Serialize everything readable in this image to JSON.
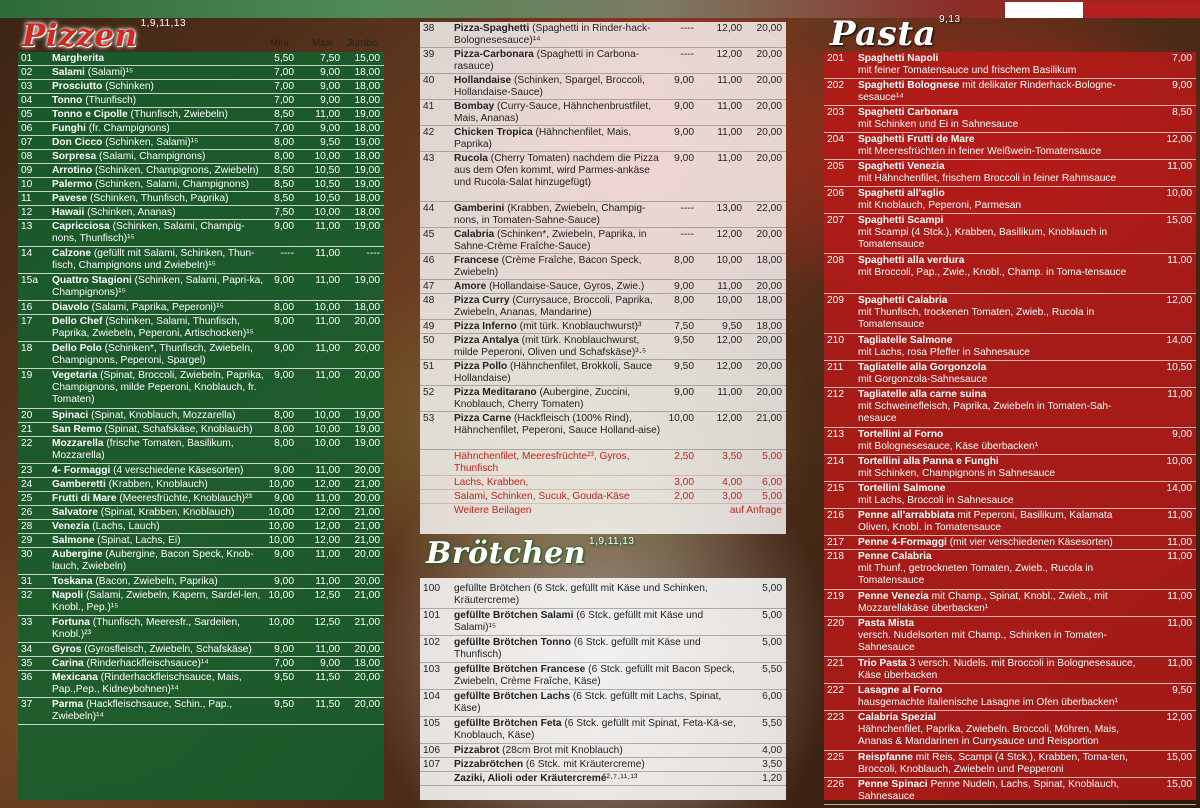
{
  "pizzen": {
    "title": "Pizzen",
    "sup": "1,9,11,13",
    "col_mini": "Mini",
    "col_maxi": "Maxi",
    "col_jumbo": "Jumbo",
    "items": [
      {
        "n": "01",
        "name": "Margherita",
        "desc": "",
        "p": [
          "5,50",
          "7,50",
          "15,00"
        ]
      },
      {
        "n": "02",
        "name": "Salami",
        "desc": " (Salami)¹⁵",
        "p": [
          "7,00",
          "9,00",
          "18,00"
        ]
      },
      {
        "n": "03",
        "name": "Prosciutto",
        "desc": " (Schinken)",
        "p": [
          "7,00",
          "9,00",
          "18,00"
        ]
      },
      {
        "n": "04",
        "name": "Tonno",
        "desc": " (Thunfisch)",
        "p": [
          "7,00",
          "9,00",
          "18,00"
        ]
      },
      {
        "n": "05",
        "name": "Tonno e Cipolle",
        "desc": " (Thunfisch, Zwiebeln)",
        "p": [
          "8,50",
          "11,00",
          "19,00"
        ]
      },
      {
        "n": "06",
        "name": "Funghi",
        "desc": " (fr. Champignons)",
        "p": [
          "7,00",
          "9,00",
          "18,00"
        ]
      },
      {
        "n": "07",
        "name": "Don Cicco",
        "desc": " (Schinken, Salami)¹⁵",
        "p": [
          "8,00",
          "9,50",
          "19,00"
        ]
      },
      {
        "n": "08",
        "name": "Sorpresa",
        "desc": " (Salami, Champignons)",
        "p": [
          "8,00",
          "10,00",
          "18,00"
        ]
      },
      {
        "n": "09",
        "name": "Arrotino",
        "desc": " (Schinken, Champignons, Zwiebeln)",
        "p": [
          "8,50",
          "10,50",
          "19,00"
        ]
      },
      {
        "n": "10",
        "name": "Palermo",
        "desc": " (Schinken, Salami, Champignons)",
        "p": [
          "8,50",
          "10,50",
          "19,00"
        ]
      },
      {
        "n": "11",
        "name": "Pavese",
        "desc": " (Schinken, Thunfisch, Paprika)",
        "p": [
          "8,50",
          "10,50",
          "18,00"
        ]
      },
      {
        "n": "12",
        "name": "Hawaii",
        "desc": " (Schinken, Ananas)",
        "p": [
          "7,50",
          "10,00",
          "18,00"
        ]
      },
      {
        "n": "13",
        "name": "Capricciosa",
        "desc": " (Schinken, Salami, Champig-nons, Thunfisch)¹⁵",
        "p": [
          "9,00",
          "11,00",
          "19,00"
        ]
      },
      {
        "n": "14",
        "name": "Calzone",
        "desc": " (gefüllt mit Salami, Schinken, Thun-fisch, Champignons und Zwiebeln)¹⁵",
        "p": [
          "----",
          "11,00",
          "----"
        ]
      },
      {
        "n": "15a",
        "name": "Quattro Stagioni",
        "desc": " (Schinken, Salami, Papri-ka, Champignons)¹⁵",
        "p": [
          "9,00",
          "11,00",
          "19,00"
        ]
      },
      {
        "n": "16",
        "name": "Diavolo",
        "desc": " (Salami, Paprika, Peperoni)¹⁵",
        "p": [
          "8,00",
          "10,00",
          "18,00"
        ]
      },
      {
        "n": "17",
        "name": "Dello Chef",
        "desc": " (Schinken, Salami, Thunfisch, Paprika, Zwiebeln, Peperoni, Artischocken)¹⁵",
        "p": [
          "9,00",
          "11,00",
          "20,00"
        ]
      },
      {
        "n": "18",
        "name": "Dello Polo",
        "desc": " (Schinken*, Thunfisch, Zwiebeln, Champignons, Peperoni, Spargel)",
        "p": [
          "9,00",
          "11,00",
          "20,00"
        ]
      },
      {
        "n": "19",
        "name": "Vegetaria",
        "desc": " (Spinat, Broccoli, Zwiebeln, Paprika, Champignons, milde Peperoni, Knoblauch, fr. Tomaten)",
        "p": [
          "9,00",
          "11,00",
          "20,00"
        ]
      },
      {
        "n": "20",
        "name": "Spinaci",
        "desc": " (Spinat, Knoblauch, Mozzarella)",
        "p": [
          "8,00",
          "10,00",
          "19,00"
        ]
      },
      {
        "n": "21",
        "name": "San Remo",
        "desc": " (Spinat, Schafskäse, Knoblauch)",
        "p": [
          "8,00",
          "10,00",
          "19,00"
        ]
      },
      {
        "n": "22",
        "name": "Mozzarella",
        "desc": " (frische Tomaten, Basilikum, Mozzarella)",
        "p": [
          "8,00",
          "10,00",
          "19,00"
        ]
      },
      {
        "n": "23",
        "name": "4- Formaggi",
        "desc": " (4 verschiedene Käsesorten)",
        "p": [
          "9,00",
          "11,00",
          "20,00"
        ]
      },
      {
        "n": "24",
        "name": "Gamberetti",
        "desc": " (Krabben, Knoblauch)",
        "p": [
          "10,00",
          "12,00",
          "21,00"
        ]
      },
      {
        "n": "25",
        "name": "Frutti di Mare",
        "desc": " (Meeresfrüchte, Knoblauch)²³",
        "p": [
          "9,00",
          "11,00",
          "20,00"
        ]
      },
      {
        "n": "26",
        "name": "Salvatore",
        "desc": " (Spinat, Krabben, Knoblauch)",
        "p": [
          "10,00",
          "12,00",
          "21,00"
        ]
      },
      {
        "n": "28",
        "name": "Venezia",
        "desc": " (Lachs, Lauch)",
        "p": [
          "10,00",
          "12,00",
          "21,00"
        ]
      },
      {
        "n": "29",
        "name": "Salmone",
        "desc": " (Spinat, Lachs, Ei)",
        "p": [
          "10,00",
          "12,00",
          "21,00"
        ]
      },
      {
        "n": "30",
        "name": "Aubergine",
        "desc": " (Aubergine, Bacon Speck, Knob-lauch, Zwiebeln)",
        "p": [
          "9,00",
          "11,00",
          "20,00"
        ]
      },
      {
        "n": "31",
        "name": "Toskana",
        "desc": " (Bacon, Zwiebeln, Paprika)",
        "p": [
          "9,00",
          "11,00",
          "20,00"
        ]
      },
      {
        "n": "32",
        "name": "Napoli",
        "desc": " (Salami, Zwiebeln, Kapern, Sardel-len, Knobl., Pep.)¹⁵",
        "p": [
          "10,00",
          "12,50",
          "21,00"
        ]
      },
      {
        "n": "33",
        "name": "Fortuna",
        "desc": " (Thunfisch, Meeresfr., Sardeilen, Knobl.)²³",
        "p": [
          "10,00",
          "12,50",
          "21,00"
        ]
      },
      {
        "n": "34",
        "name": "Gyros",
        "desc": " (Gyrosfleisch, Zwiebeln, Schafskäse)",
        "p": [
          "9,00",
          "11,00",
          "20,00"
        ]
      },
      {
        "n": "35",
        "name": "Carina",
        "desc": " (Rinderhackfleischsauce)¹⁴",
        "p": [
          "7,00",
          "9,00",
          "18,00"
        ]
      },
      {
        "n": "36",
        "name": "Mexicana",
        "desc": " (Rinderhackfleischsauce, Mais, Pap.,Pep., Kidneybohnen)¹⁴",
        "p": [
          "9,50",
          "11,50",
          "20,00"
        ]
      },
      {
        "n": "37",
        "name": "Parma",
        "desc": " (Hackfleischsauce, Schin., Pap., Zwiebeln)¹⁴",
        "p": [
          "9,50",
          "11,50",
          "20,00"
        ]
      }
    ]
  },
  "pizzen2": {
    "items": [
      {
        "n": "38",
        "name": "Pizza-Spaghetti",
        "desc": " (Spaghetti in Rinder-hack-Bolognesesauce)¹⁴",
        "p": [
          "----",
          "12,00",
          "20,00"
        ]
      },
      {
        "n": "39",
        "name": "Pizza-Carbonara",
        "desc": " (Spaghetti in Carbona-rasauce)",
        "p": [
          "----",
          "12,00",
          "20,00"
        ]
      },
      {
        "n": "40",
        "name": "Hollandaise",
        "desc": " (Schinken, Spargel, Broccoli, Hollandaise-Sauce)",
        "p": [
          "9,00",
          "11,00",
          "20,00"
        ]
      },
      {
        "n": "41",
        "name": "Bombay",
        "desc": " (Curry-Sauce, Hähnchenbrustfilet, Mais, Ananas)",
        "p": [
          "9,00",
          "11,00",
          "20,00"
        ]
      },
      {
        "n": "42",
        "name": "Chicken Tropica",
        "desc": " (Hähnchenfilet, Mais, Paprika)",
        "p": [
          "9,00",
          "11,00",
          "20,00"
        ]
      },
      {
        "n": "43",
        "name": "Rucola",
        "desc": " (Cherry Tomaten) nachdem die Pizza aus dem Ofen kommt, wird Parmes-ankäse und Rucola-Salat hinzugefügt)",
        "p": [
          "9,00",
          "11,00",
          "20,00"
        ]
      },
      {
        "n": "44",
        "name": "Gamberini",
        "desc": " (Krabben, Zwiebeln, Champig-nons, in Tomaten-Sahne-Sauce)",
        "p": [
          "----",
          "13,00",
          "22,00"
        ]
      },
      {
        "n": "45",
        "name": "Calabria",
        "desc": " (Schinken*, Zwiebeln, Paprika, in Sahne-Crème Fraîche-Sauce)",
        "p": [
          "----",
          "12,00",
          "20,00"
        ]
      },
      {
        "n": "46",
        "name": "Francese",
        "desc": " (Crème Fraîche, Bacon Speck, Zwiebeln)",
        "p": [
          "8,00",
          "10,00",
          "18,00"
        ]
      },
      {
        "n": "47",
        "name": "Amore",
        "desc": " (Hollandaise-Sauce, Gyros, Zwie.)",
        "p": [
          "9,00",
          "11,00",
          "20,00"
        ]
      },
      {
        "n": "48",
        "name": "Pizza Curry",
        "desc": " (Currysauce, Broccoli, Paprika, Zwiebeln, Ananas, Mandarine)",
        "p": [
          "8,00",
          "10,00",
          "18,00"
        ]
      },
      {
        "n": "49",
        "name": "Pizza Inferno",
        "desc": " (mit türk. Knoblauchwurst)³",
        "p": [
          "7,50",
          "9,50",
          "18,00"
        ]
      },
      {
        "n": "50",
        "name": "Pizza Antalya",
        "desc": " (mit türk. Knoblauchwurst, milde Peperoni, Oliven und Schafskäse)³·⁵",
        "p": [
          "9,50",
          "12,00",
          "20,00"
        ]
      },
      {
        "n": "51",
        "name": "Pizza Pollo",
        "desc": " (Hähnchenfilet, Brokkoli, Sauce Hollandaise)",
        "p": [
          "9,50",
          "12,00",
          "20,00"
        ]
      },
      {
        "n": "52",
        "name": "Pizza Meditarano",
        "desc": " (Aubergine, Zuccini, Knoblauch, Cherry Tomaten)",
        "p": [
          "9,00",
          "11,00",
          "20,00"
        ]
      },
      {
        "n": "53",
        "name": "Pizza Carne",
        "desc": " (Hackfleisch (100% Rind), Hähnchenfilet, Peperoni, Sauce Holland-aise)",
        "p": [
          "10,00",
          "12,00",
          "21,00"
        ]
      }
    ],
    "extras": [
      {
        "desc": "Hähnchenfilet, Meeresfrüchte²³, Gyros, Thunfisch",
        "p": [
          "2,50",
          "3,50",
          "5,00"
        ]
      },
      {
        "desc": "Lachs, Krabben,",
        "p": [
          "3,00",
          "4,00",
          "6,00"
        ]
      },
      {
        "desc": "Salami, Schinken, Sucuk, Gouda-Käse",
        "p": [
          "2,00",
          "3,00",
          "5,00"
        ]
      }
    ],
    "extra_more": "Weitere Beilagen",
    "extra_more_price": "auf Anfrage"
  },
  "broetchen": {
    "title": "Brötchen",
    "sup": "1,9,11,13",
    "items": [
      {
        "n": "100",
        "name": "",
        "desc": "gefüllte Brötchen (6 Stck. gefüllt mit Käse und Schinken, Kräutercreme)",
        "p": "5,00"
      },
      {
        "n": "101",
        "name": "gefüllte Brötchen Salami",
        "desc": " (6 Stck. gefüllt mit Käse und Salami)¹⁵",
        "p": "5,00"
      },
      {
        "n": "102",
        "name": "gefüllte Brötchen Tonno",
        "desc": " (6 Stck. gefüllt mit Käse und Thunfisch)",
        "p": "5,00"
      },
      {
        "n": "103",
        "name": "gefüllte Brötchen Francese",
        "desc": " (6 Stck. gefüllt mit Bacon Speck, Zwiebeln, Crème Fraîche, Käse)",
        "p": "5,50"
      },
      {
        "n": "104",
        "name": "gefüllte Brötchen Lachs",
        "desc": " (6 Stck. gefüllt mit Lachs, Spinat, Käse)",
        "p": "6,00"
      },
      {
        "n": "105",
        "name": "gefüllte Brötchen Feta",
        "desc": " (6 Stck. gefüllt mit Spinat, Feta-Kä-se, Knoblauch, Käse)",
        "p": "5,50"
      },
      {
        "n": "106",
        "name": "Pizzabrot",
        "desc": " (28cm Brot mit Knoblauch)",
        "p": "4,00"
      },
      {
        "n": "107",
        "name": "Pizzabrötchen",
        "desc": " (6 Stck. mit Kräutercreme)",
        "p": "3,50"
      },
      {
        "n": "",
        "name": "Zaziki, Alioli oder Kräutercremé",
        "desc": "²·⁷·¹¹·¹³",
        "p": "1,20"
      }
    ]
  },
  "pasta": {
    "title": "Pasta",
    "sup": "9,13",
    "items": [
      {
        "n": "201",
        "name": "Spaghetti Napoli",
        "desc": "mit feiner Tomatensauce und frischem Basilikum",
        "p": "7,00",
        "two": true
      },
      {
        "n": "202",
        "name": "Spaghetti Bolognese",
        "desc": " mit delikater Rinderhack-Bologne-sesauce¹⁴",
        "p": "9,00",
        "two": false
      },
      {
        "n": "203",
        "name": "Spaghetti Carbonara",
        "desc": "mit Schinken und Ei in Sahnesauce",
        "p": "8,50",
        "two": true
      },
      {
        "n": "204",
        "name": "Spaghetti Frutti de Mare",
        "desc": "mit Meeresfrüchten in feiner Weißwein-Tomatensauce",
        "p": "12,00",
        "two": true
      },
      {
        "n": "205",
        "name": "Spaghetti Venezia",
        "desc": "mit Hähnchenfilet, frischem Broccoli in feiner Rahmsauce",
        "p": "11,00",
        "two": true
      },
      {
        "n": "206",
        "name": "Spaghetti all'aglio",
        "desc": "mit Knoblauch, Peperoni, Parmesan",
        "p": "10,00",
        "two": true
      },
      {
        "n": "207",
        "name": "Spaghetti Scampi",
        "desc": "mit Scampi (4 Stck.), Krabben, Basilikum, Knoblauch in Tomatensauce",
        "p": "15,00",
        "two": true
      },
      {
        "n": "208",
        "name": "Spaghetti alla verdura",
        "desc": "mit Broccoli, Pap., Zwie., Knobl., Champ. in Toma-tensauce",
        "p": "11,00",
        "two": true
      },
      {
        "n": "209",
        "name": "Spaghetti Calabria",
        "desc": "mit Thunfisch, trockenen Tomaten, Zwieb., Rucola in Tomatensauce",
        "p": "12,00",
        "two": true
      },
      {
        "n": "210",
        "name": "Tagliatelle Salmone",
        "desc": "mit Lachs, rosa Pfeffer in Sahnesauce",
        "p": "14,00",
        "two": true
      },
      {
        "n": "211",
        "name": "Tagliatelle alla Gorgonzola",
        "desc": "mit Gorgonzola-Sahnesauce",
        "p": "10,50",
        "two": true
      },
      {
        "n": "212",
        "name": "Tagliatelle alla carne suina",
        "desc": "mit Schweinefleisch, Paprika, Zwiebeln in Tomaten-Sah-nesauce",
        "p": "11,00",
        "two": true
      },
      {
        "n": "213",
        "name": "Tortellini al Forno",
        "desc": "mit Bolognesesauce, Käse überbacken¹",
        "p": "9,00",
        "two": true
      },
      {
        "n": "214",
        "name": "Tortellini alla Panna e Funghi",
        "desc": "mit Schinken, Champignons in Sahnesauce",
        "p": "10,00",
        "two": true
      },
      {
        "n": "215",
        "name": "Tortellini Salmone",
        "desc": "mit Lachs, Broccoli in Sahnesauce",
        "p": "14,00",
        "two": true
      },
      {
        "n": "216",
        "name": "Penne all'arrabbiata",
        "desc": " mit Peperoni, Basilikum, Kalamata Oliven, Knobl. in Tomatensauce",
        "p": "11,00",
        "two": false
      },
      {
        "n": "217",
        "name": "Penne 4-Formaggi",
        "desc": " (mit vier verschiedenen Käsesorten)",
        "p": "11,00",
        "two": false
      },
      {
        "n": "218",
        "name": "Penne Calabria",
        "desc": "mit Thunf., getrockneten Tomaten, Zwieb., Rucola in Tomatensauce",
        "p": "11,00",
        "two": true
      },
      {
        "n": "219",
        "name": "Penne Venezia",
        "desc": " mit Champ., Spinat, Knobl., Zwieb., mit Mozzarellakäse überbacken¹",
        "p": "11,00",
        "two": false
      },
      {
        "n": "220",
        "name": "Pasta Mista",
        "desc": "versch. Nudelsorten mit Champ., Schinken in Tomaten-Sahnesauce",
        "p": "11,00",
        "two": true
      },
      {
        "n": "221",
        "name": "Trio Pasta",
        "desc": "  3 versch. Nudels. mit Broccoli in Bolognesesauce, Käse überbacken",
        "p": "11,00",
        "two": false
      },
      {
        "n": "222",
        "name": "Lasagne al Forno",
        "desc": "hausgemachte italienische Lasagne im Ofen überbacken¹",
        "p": "9,50",
        "two": true
      },
      {
        "n": "223",
        "name": "Calabria Spezial",
        "desc": "Hähnchenfilet, Paprika, Zwiebeln. Broccoli, Möhren, Mais, Ananas & Mandarinen in Currysauce und Reisportion",
        "p": "12,00",
        "two": true
      },
      {
        "n": "225",
        "name": "Reispfanne",
        "desc": " mit Reis, Scampi (4 Stck.), Krabben, Toma-ten, Broccoli, Knoblauch, Zwiebeln und Pepperoni",
        "p": "15,00",
        "two": false
      },
      {
        "n": "226",
        "name": "Penne Spinaci",
        "desc": " Penne Nudeln, Lachs, Spinat, Knoblauch, Sahnesauce",
        "p": "15,00",
        "two": false
      }
    ]
  }
}
